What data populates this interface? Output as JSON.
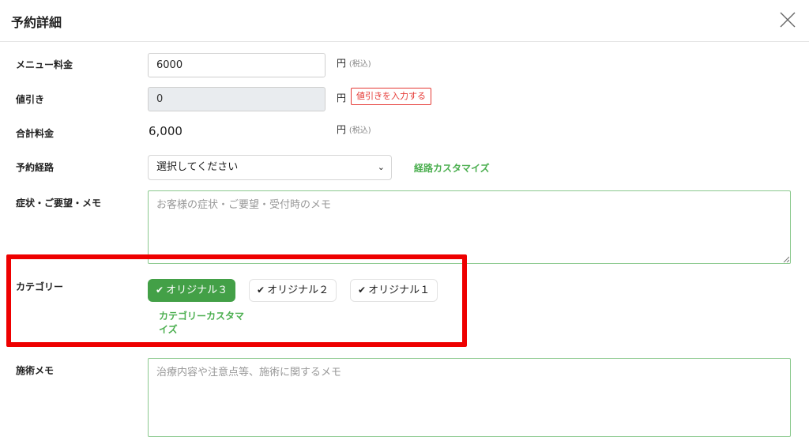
{
  "header": {
    "title": "予約詳細",
    "close_icon": "close-icon"
  },
  "menu_price": {
    "label": "メニュー料金",
    "value": "6000",
    "unit": "円",
    "tax_note": "(税込)"
  },
  "discount": {
    "label": "値引き",
    "value": "0",
    "unit": "円",
    "button_label": "値引きを入力する"
  },
  "total": {
    "label": "合計料金",
    "value": "6,000",
    "unit": "円",
    "tax_note": "(税込)"
  },
  "route": {
    "label": "予約経路",
    "selected": "選択してください",
    "customize_link": "経路カスタマイズ"
  },
  "symptom": {
    "label": "症状・ご要望・メモ",
    "placeholder": "お客様の症状・ご要望・受付時のメモ"
  },
  "category": {
    "label": "カテゴリー",
    "chips": [
      {
        "label": "オリジナル３",
        "selected": true
      },
      {
        "label": "オリジナル２",
        "selected": false
      },
      {
        "label": "オリジナル１",
        "selected": false
      }
    ],
    "customize_link": "カテゴリーカスタマイズ"
  },
  "treatment_memo": {
    "label": "施術メモ",
    "placeholder": "治療内容や注意点等、施術に関するメモ"
  },
  "colors": {
    "accent_green": "#43a047",
    "link_green": "#4caf50",
    "alert_red": "#e53935",
    "highlight_red": "#ee0000"
  }
}
